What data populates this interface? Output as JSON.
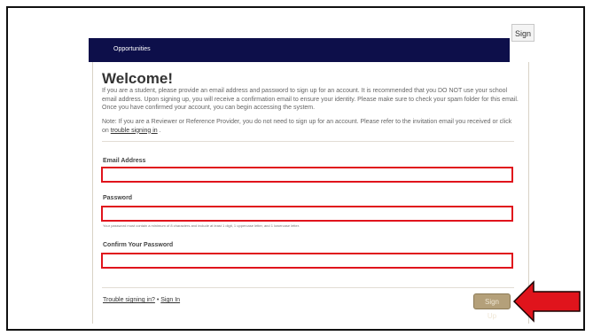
{
  "header": {
    "title": "Opportunities"
  },
  "sign_tab": {
    "label": "Sign"
  },
  "welcome": {
    "heading": "Welcome!",
    "intro": "If you are a student, please provide an email address and password to sign up for an account. It is recommended that you DO NOT use your school email address. Upon signing up, you will receive a confirmation email to ensure your identity. Please make sure to check your spam folder for this email. Once you have confirmed your account, you can begin accessing the system.",
    "note_prefix": "Note: If you are a Reviewer or Reference Provider, you do not need to sign up for an account. Please refer to the invitation email you received or click on",
    "note_link": "trouble signing in",
    "note_suffix": "."
  },
  "form": {
    "email_label": "Email Address",
    "email_value": "",
    "password_label": "Password",
    "password_value": "",
    "password_hint": "Your password must contain a minimum of 8 characters and include at least 1 digit, 1 uppercase letter, and 1 lowercase letter.",
    "confirm_label": "Confirm Your Password",
    "confirm_value": ""
  },
  "footer": {
    "trouble_link": "Trouble signing in?",
    "separator": "•",
    "sign_in_link": "Sign In",
    "signup_button": "Sign Up"
  },
  "colors": {
    "header_bg": "#0d0f4a",
    "highlight_border": "#e0141c",
    "arrow": "#e0141c",
    "button_bg": "#b4a07a"
  },
  "icons": {
    "pointer": "red-arrow-icon"
  }
}
